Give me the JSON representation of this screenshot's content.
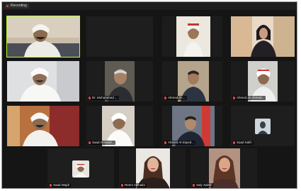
{
  "meeting": {
    "recording_label": "Recording"
  },
  "tiles": [
    {
      "name_label": "",
      "has_video": true,
      "active": true
    },
    {
      "name_label": "",
      "has_video": true
    },
    {
      "name_label": "",
      "has_video": true
    },
    {
      "name_label": "",
      "has_video": true
    },
    {
      "name_label": "Dr. Mohammed ...",
      "has_video": true
    },
    {
      "name_label": "Ahmed Al-...",
      "has_video": true
    },
    {
      "name_label": "Ahmed Ali Ahmed...",
      "has_video": true
    },
    {
      "name_label": "",
      "has_video": true
    },
    {
      "name_label": "Saad Al-Saad...",
      "has_video": true
    },
    {
      "name_label": "Ahmed Al-Zayed...",
      "has_video": true
    },
    {
      "name_label": "Saad Salih",
      "has_video": false
    },
    {
      "name_label": "Saad Wajdi",
      "has_video": false
    },
    {
      "name_label": "Reem Alshaibi",
      "has_video": true
    },
    {
      "name_label": "Saly Saleh",
      "has_video": true
    }
  ],
  "colors": {
    "active_speaker_outline": "#b6ff2a",
    "tile_background": "#222222",
    "meeting_background": "#151515"
  }
}
